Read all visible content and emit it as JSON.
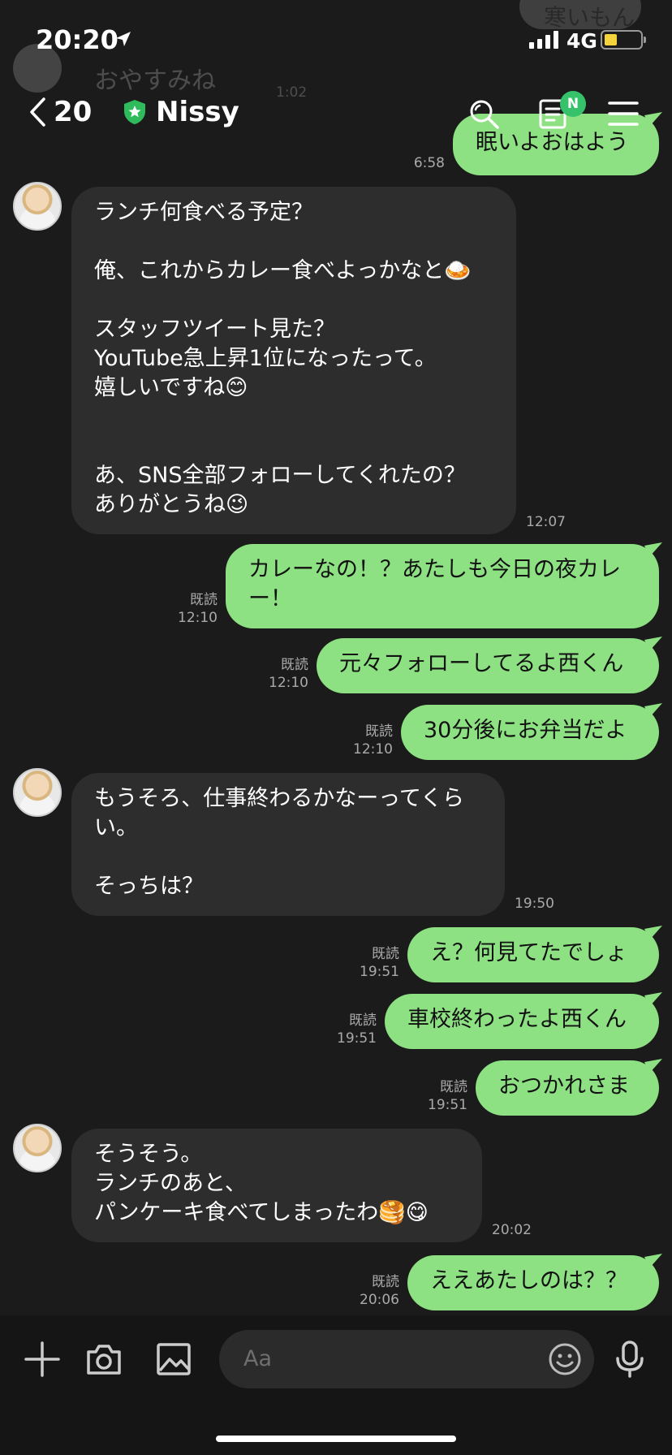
{
  "status_bar": {
    "time": "20:20",
    "network": "4G",
    "battery_level": 0.35,
    "signal_bars": 4
  },
  "background_ghost": {
    "top_text": "寒いもん",
    "ghost_message": "おやすみね",
    "ghost_time": "1:02"
  },
  "header": {
    "unread_count": "20",
    "chat_name": "Nissy",
    "notes_badge": "N"
  },
  "messages": [
    {
      "side": "out",
      "text": "眠いよおはよう",
      "read": "",
      "time": "6:58"
    },
    {
      "side": "in",
      "text": "ランチ何食べる予定？\n\n俺、これからカレー食べよっかなと🍛\n\nスタッフツイート見た？\nYouTube急上昇1位になったって。\n嬉しいですね😊\n\n\nあ、SNS全部フォローしてくれたの？\nありがとうね😉",
      "time": "12:07"
    },
    {
      "side": "out",
      "text": "カレーなの！？あたしも今日の夜カレ\nー！",
      "read": "既読",
      "time": "12:10"
    },
    {
      "side": "out",
      "text": "元々フォローしてるよ西くん",
      "read": "既読",
      "time": "12:10"
    },
    {
      "side": "out",
      "text": "30分後にお弁当だよ",
      "read": "既読",
      "time": "12:10"
    },
    {
      "side": "in",
      "text": "もうそろ、仕事終わるかなーってくら\nい。\n\nそっちは？",
      "time": "19:50"
    },
    {
      "side": "out",
      "text": "え？何見てたでしょ",
      "read": "既読",
      "time": "19:51"
    },
    {
      "side": "out",
      "text": "車校終わったよ西くん",
      "read": "既読",
      "time": "19:51"
    },
    {
      "side": "out",
      "text": "おつかれさま",
      "read": "既読",
      "time": "19:51"
    },
    {
      "side": "in",
      "text": "そうそう。\nランチのあと、\nパンケーキ食べてしまったわ🥞😋",
      "time": "20:02"
    },
    {
      "side": "out",
      "text": "ええあたしのは？？",
      "read": "既読",
      "time": "20:06"
    }
  ],
  "input": {
    "placeholder": "Aa"
  },
  "colors": {
    "background": "#1b1b1b",
    "incoming_bubble": "#2d2d2d",
    "outgoing_bubble": "#8de183",
    "badge": "#36c26a"
  },
  "icons": [
    "location-arrow-icon",
    "back-chevron-icon",
    "shield-star-icon",
    "search-icon",
    "notes-icon",
    "menu-icon",
    "plus-icon",
    "camera-icon",
    "image-icon",
    "emoji-icon",
    "microphone-icon"
  ]
}
